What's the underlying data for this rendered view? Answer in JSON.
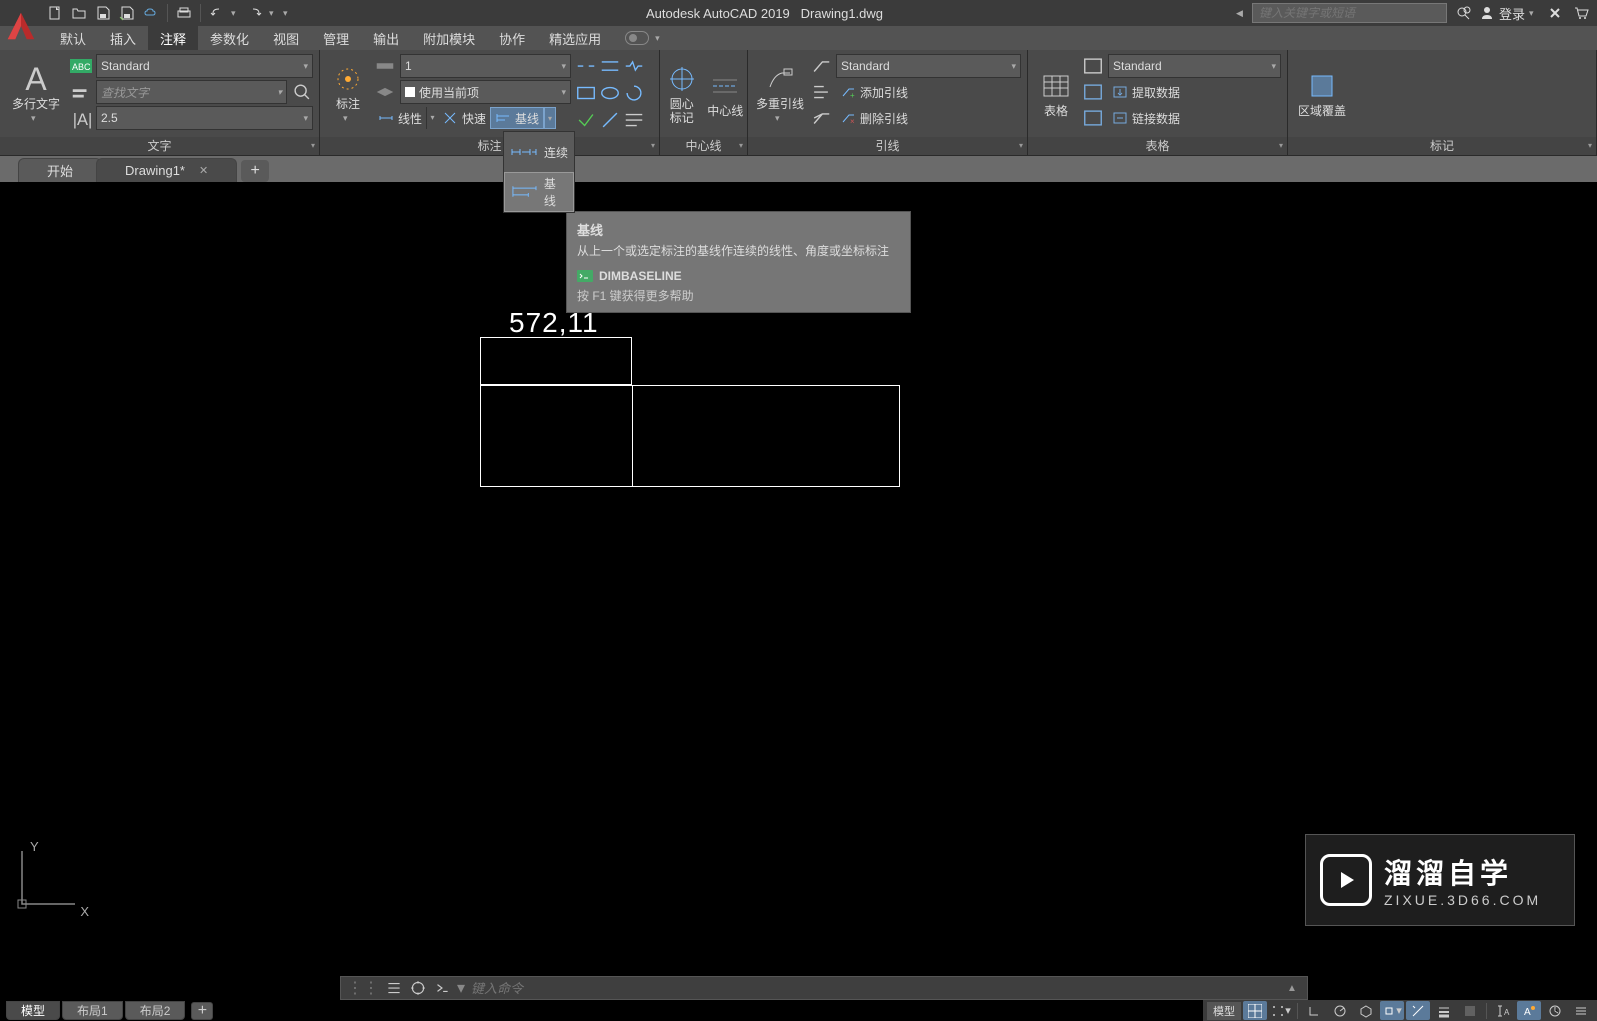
{
  "titlebar": {
    "app": "Autodesk AutoCAD 2019",
    "file": "Drawing1.dwg",
    "search_placeholder": "键入关键字或短语",
    "login": "登录"
  },
  "menubar": {
    "items": [
      "默认",
      "插入",
      "注释",
      "参数化",
      "视图",
      "管理",
      "输出",
      "附加模块",
      "协作",
      "精选应用"
    ],
    "active_index": 2
  },
  "ribbon": {
    "panels": {
      "text": {
        "title": "文字",
        "mtext": "多行文字",
        "style": "Standard",
        "find_placeholder": "查找文字",
        "height": "2.5"
      },
      "dim": {
        "title": "标注",
        "main": "标注",
        "scale": "1",
        "layer": "使用当前项",
        "linear": "线性",
        "quick": "快速",
        "baseline": "基线"
      },
      "center": {
        "title": "中心线",
        "mark": "圆心\n标记",
        "line": "中心线"
      },
      "leader": {
        "title": "引线",
        "mleader": "多重引线",
        "style": "Standard",
        "add": "添加引线",
        "remove": "删除引线"
      },
      "table": {
        "title": "表格",
        "main": "表格",
        "style": "Standard",
        "extract": "提取数据",
        "link": "链接数据"
      },
      "markup": {
        "title": "标记",
        "wipeout": "区域覆盖"
      }
    }
  },
  "filetabs": {
    "start": "开始",
    "drawing": "Drawing1*"
  },
  "dropdown": {
    "continue": "连续",
    "baseline": "基线"
  },
  "tooltip": {
    "title": "基线",
    "desc": "从上一个或选定标注的基线作连续的线性、角度或坐标标注",
    "cmd": "DIMBASELINE",
    "help": "按 F1 键获得更多帮助"
  },
  "canvas": {
    "dim_value": "572,11",
    "axes": {
      "x": "X",
      "y": "Y"
    }
  },
  "cmdline": {
    "placeholder": "键入命令"
  },
  "layout_tabs": [
    "模型",
    "布局1",
    "布局2"
  ],
  "statusbar": {
    "model": "模型"
  },
  "watermark": {
    "big": "溜溜自学",
    "small": "ZIXUE.3D66.COM"
  }
}
